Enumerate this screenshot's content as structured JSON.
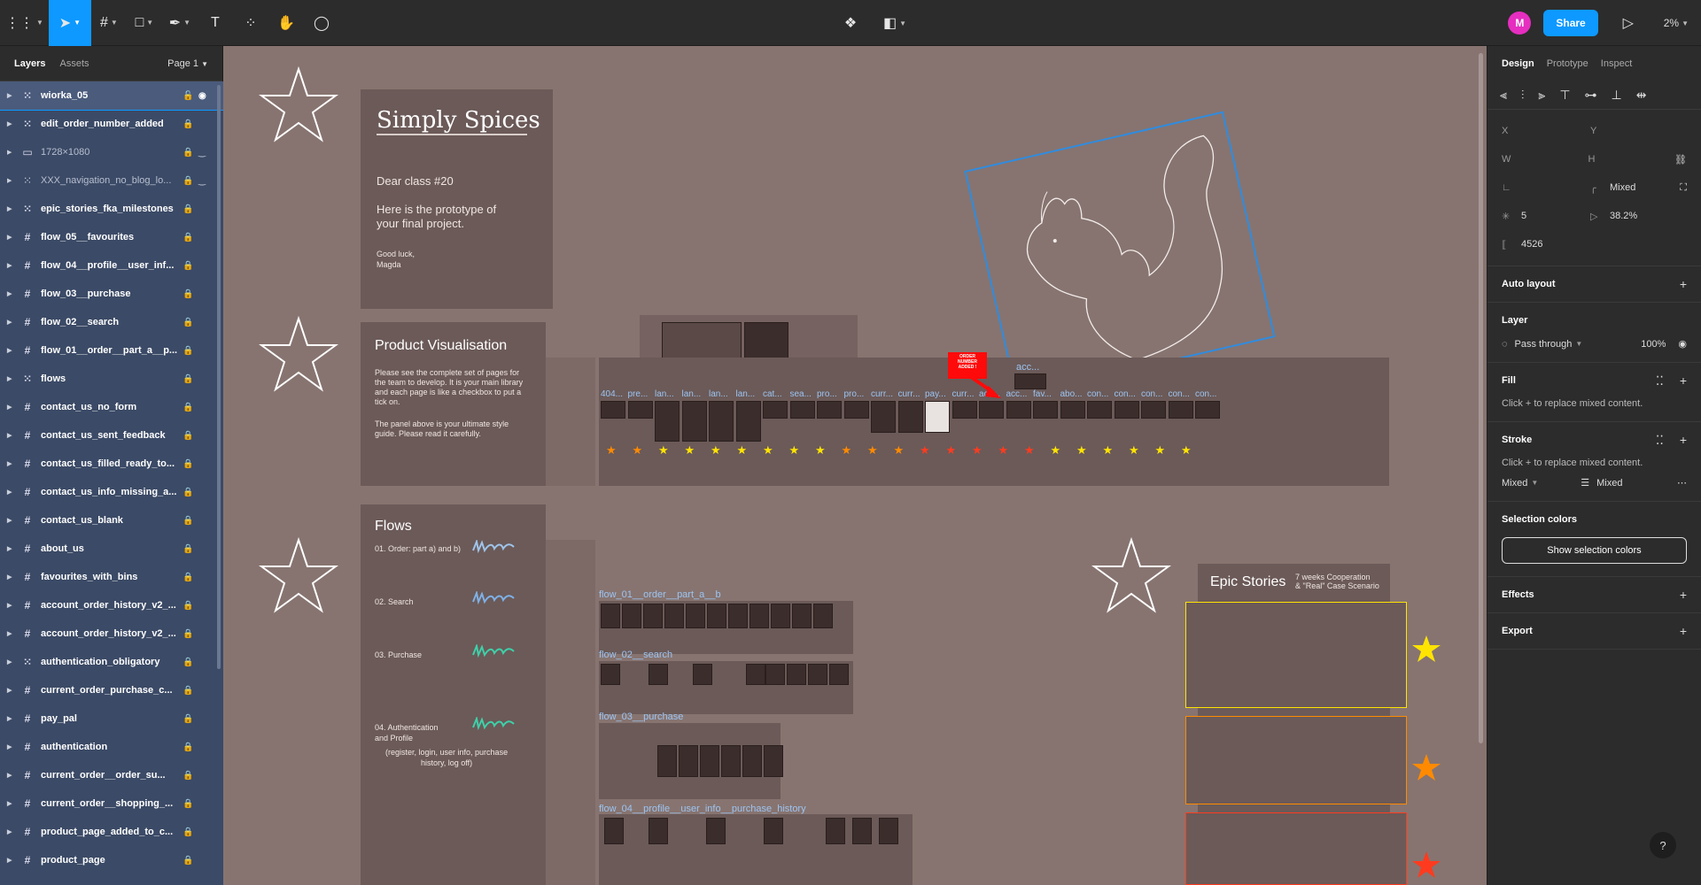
{
  "toolbar": {
    "zoom": "2%",
    "share_label": "Share",
    "avatar_initial": "M"
  },
  "left_panel": {
    "tab_layers": "Layers",
    "tab_assets": "Assets",
    "page_label": "Page 1",
    "layers": [
      {
        "name": "wiorka_05",
        "icon": "dashed-frame-icon",
        "selected": true,
        "dim": false
      },
      {
        "name": "edit_order_number_added",
        "icon": "dashed-frame-icon",
        "selected": false,
        "dim": false
      },
      {
        "name": "1728×1080",
        "icon": "image-icon",
        "selected": false,
        "dim": true
      },
      {
        "name": "XXX_navigation_no_blog_lo...",
        "icon": "dashed-frame-icon",
        "selected": false,
        "dim": true
      },
      {
        "name": "epic_stories_fka_milestones",
        "icon": "dashed-frame-icon",
        "selected": false,
        "dim": false
      },
      {
        "name": "flow_05__favourites",
        "icon": "frame-icon",
        "selected": false,
        "dim": false
      },
      {
        "name": "flow_04__profile__user_inf...",
        "icon": "frame-icon",
        "selected": false,
        "dim": false
      },
      {
        "name": "flow_03__purchase",
        "icon": "frame-icon",
        "selected": false,
        "dim": false
      },
      {
        "name": "flow_02__search",
        "icon": "frame-icon",
        "selected": false,
        "dim": false
      },
      {
        "name": "flow_01__order__part_a__p...",
        "icon": "frame-icon",
        "selected": false,
        "dim": false
      },
      {
        "name": "flows",
        "icon": "dashed-frame-icon",
        "selected": false,
        "dim": false
      },
      {
        "name": "contact_us_no_form",
        "icon": "frame-icon",
        "selected": false,
        "dim": false
      },
      {
        "name": "contact_us_sent_feedback",
        "icon": "frame-icon",
        "selected": false,
        "dim": false
      },
      {
        "name": "contact_us_filled_ready_to...",
        "icon": "frame-icon",
        "selected": false,
        "dim": false
      },
      {
        "name": "contact_us_info_missing_a...",
        "icon": "frame-icon",
        "selected": false,
        "dim": false
      },
      {
        "name": "contact_us_blank",
        "icon": "frame-icon",
        "selected": false,
        "dim": false
      },
      {
        "name": "about_us",
        "icon": "frame-icon",
        "selected": false,
        "dim": false
      },
      {
        "name": "favourites_with_bins",
        "icon": "frame-icon",
        "selected": false,
        "dim": false
      },
      {
        "name": "account_order_history_v2_...",
        "icon": "frame-icon",
        "selected": false,
        "dim": false
      },
      {
        "name": "account_order_history_v2_...",
        "icon": "frame-icon",
        "selected": false,
        "dim": false
      },
      {
        "name": "authentication_obligatory",
        "icon": "dashed-frame-icon",
        "selected": false,
        "dim": false
      },
      {
        "name": "current_order_purchase_c...",
        "icon": "frame-icon",
        "selected": false,
        "dim": false
      },
      {
        "name": "pay_pal",
        "icon": "frame-icon",
        "selected": false,
        "dim": false
      },
      {
        "name": "authentication",
        "icon": "frame-icon",
        "selected": false,
        "dim": false
      },
      {
        "name": "current_order__order_su...",
        "icon": "frame-icon",
        "selected": false,
        "dim": false
      },
      {
        "name": "current_order__shopping_...",
        "icon": "frame-icon",
        "selected": false,
        "dim": false
      },
      {
        "name": "product_page_added_to_c...",
        "icon": "frame-icon",
        "selected": false,
        "dim": false
      },
      {
        "name": "product_page",
        "icon": "frame-icon",
        "selected": false,
        "dim": false
      }
    ]
  },
  "canvas": {
    "intro_title": "Simply Spices",
    "intro_greeting": "Dear class #20",
    "intro_body": "Here is the prototype of your final project.",
    "intro_signoff": "Good luck,",
    "intro_name": "Magda",
    "pv_title": "Product Visualisation",
    "pv_body1": "Please see the complete set of pages for the team to develop.  It is your main library and each page is like a checkbox to put a tick on.",
    "pv_body2": "The panel above is your ultimate style guide. Please read it carefully.",
    "order_note": "ORDER NUMBER ADDED !",
    "page_labels": [
      "404...",
      "pre...",
      "lan...",
      "lan...",
      "lan...",
      "lan...",
      "cat...",
      "sea...",
      "pro...",
      "pro...",
      "curr...",
      "curr...",
      "pay...",
      "curr...",
      "acc...",
      "acc...",
      "fav...",
      "abo...",
      "con...",
      "con...",
      "con...",
      "con...",
      "con..."
    ],
    "top_label": "acc...",
    "flows_title": "Flows",
    "flow_items": [
      "01. Order: part a) and b)",
      "02. Search",
      "03. Purchase",
      "04. Authentication\nand Profile",
      "(register, login, user info, purchase\nhistory, log off)"
    ],
    "flow_labels": [
      "flow_01__order__part_a__b",
      "flow_02__search",
      "flow_03__purchase",
      "flow_04__profile__user_info__purchase_history"
    ],
    "epic_title": "Epic Stories",
    "epic_subtitle": "7 weeks Cooperation\n& \"Real\" Case Scenario"
  },
  "right_panel": {
    "tab_design": "Design",
    "tab_prototype": "Prototype",
    "tab_inspect": "Inspect",
    "x_label": "X",
    "y_label": "Y",
    "w_label": "W",
    "h_label": "H",
    "radius_value": "Mixed",
    "count_value": "5",
    "ratio_value": "38.2%",
    "spacing_value": "4526",
    "auto_layout": "Auto layout",
    "layer_title": "Layer",
    "blend_mode": "Pass through",
    "opacity": "100%",
    "fill_title": "Fill",
    "fill_hint": "Click + to replace mixed content.",
    "stroke_title": "Stroke",
    "stroke_hint": "Click + to replace mixed content.",
    "stroke_mixed1": "Mixed",
    "stroke_mixed2": "Mixed",
    "selection_colors": "Selection colors",
    "show_selection_colors": "Show selection colors",
    "effects": "Effects",
    "export": "Export",
    "help": "?"
  },
  "colors": {
    "accent": "#0d99ff",
    "canvas_bg": "#877470",
    "layers_bg": "#3b4a66",
    "star_yellow": "#ffe400",
    "star_orange": "#ff8a00",
    "star_red": "#ff3b1f"
  }
}
